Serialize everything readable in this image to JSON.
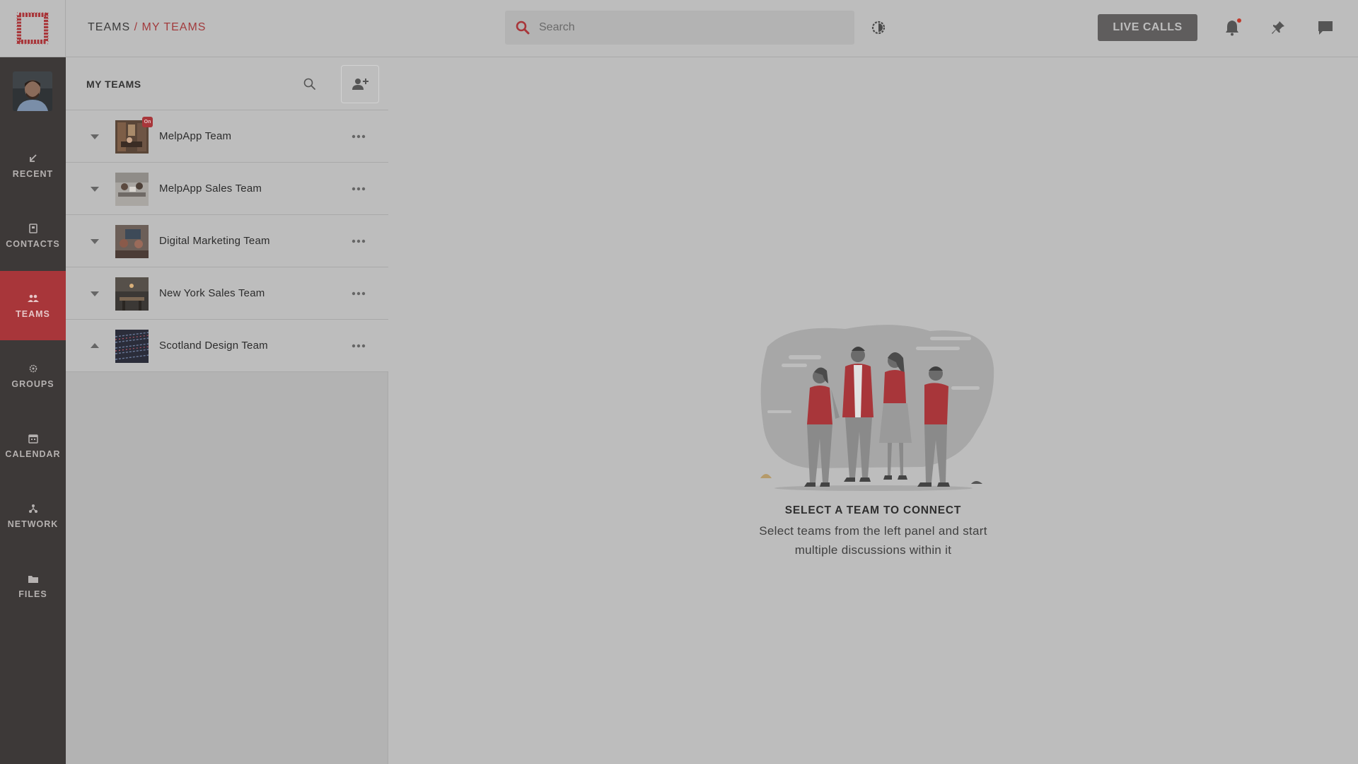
{
  "breadcrumb": {
    "root": "TEAMS",
    "separator": "/",
    "current": "MY TEAMS"
  },
  "search": {
    "placeholder": "Search",
    "value": ""
  },
  "header": {
    "live_calls_label": "LIVE CALLS"
  },
  "nav": {
    "items": [
      {
        "label": "RECENT",
        "icon": "recent-arrow-icon"
      },
      {
        "label": "CONTACTS",
        "icon": "contacts-book-icon"
      },
      {
        "label": "TEAMS",
        "icon": "teams-people-icon",
        "active": true
      },
      {
        "label": "GROUPS",
        "icon": "groups-gear-icon"
      },
      {
        "label": "CALENDAR",
        "icon": "calendar-icon"
      },
      {
        "label": "NETWORK",
        "icon": "network-icon"
      },
      {
        "label": "FILES",
        "icon": "folder-icon"
      }
    ]
  },
  "teams_panel": {
    "title": "MY TEAMS",
    "teams": [
      {
        "name": "MelpApp Team",
        "badge": "On",
        "expanded": false
      },
      {
        "name": "MelpApp Sales Team",
        "expanded": false
      },
      {
        "name": "Digital Marketing Team",
        "expanded": false
      },
      {
        "name": "New York Sales Team",
        "expanded": false
      },
      {
        "name": "Scotland Design Team",
        "expanded": true
      }
    ]
  },
  "empty_state": {
    "title": "SELECT A TEAM TO CONNECT",
    "subtitle_line1": "Select teams from the left panel and start",
    "subtitle_line2": "multiple discussions within it"
  },
  "colors": {
    "accent": "#a8363a",
    "nav_bg": "#3d3938",
    "overlay_bg": "#bdbdbd",
    "button_dark": "#5f5d5d"
  }
}
